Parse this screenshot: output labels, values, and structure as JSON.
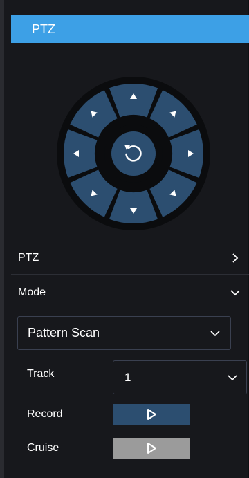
{
  "header": {
    "title": "PTZ"
  },
  "sections": {
    "ptz_label": "PTZ",
    "mode_label": "Mode"
  },
  "mode_select": {
    "value": "Pattern Scan"
  },
  "fields": {
    "track_label": "Track",
    "track_value": "1",
    "record_label": "Record",
    "cruise_label": "Cruise"
  },
  "colors": {
    "header_bg": "#3da0e6",
    "dial_ring": "#2c4e70",
    "dial_outer": "#0b0c0e",
    "record_btn": "#2c4e70",
    "cruise_btn": "#9b9b9b"
  },
  "icons": {
    "dial_center": "refresh-icon",
    "dial_arrows": [
      "up",
      "up-right",
      "right",
      "down-right",
      "down",
      "down-left",
      "left",
      "up-left"
    ],
    "ptz_chevron": "chevron-right-icon",
    "mode_chevron": "chevron-down-icon",
    "play": "play-icon"
  }
}
